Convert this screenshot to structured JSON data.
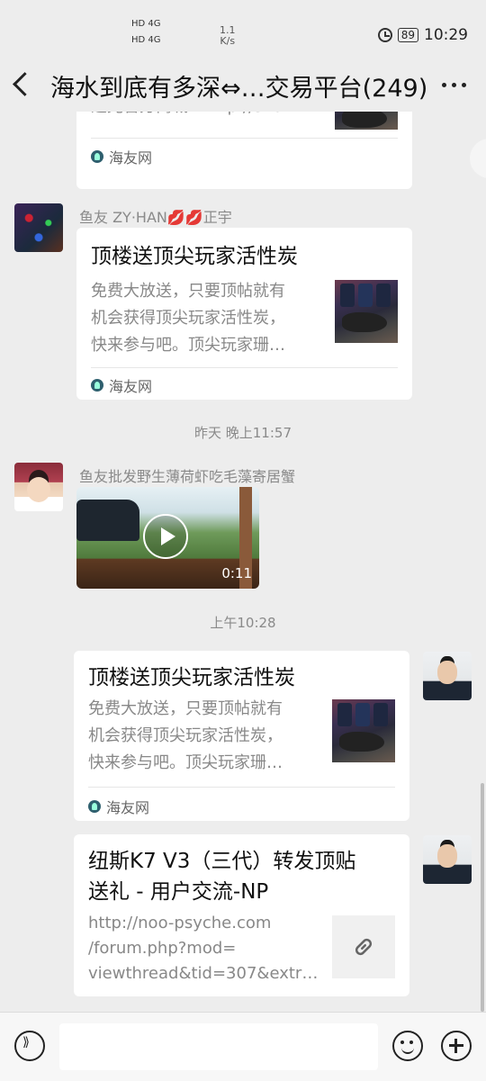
{
  "status_bar": {
    "sig1": "HD 4G",
    "sig2": "HD 4G",
    "speed_value": "1.1",
    "speed_unit": "K/s",
    "battery": "89",
    "time": "10:29"
  },
  "header": {
    "title": "海水到底有多深⇔…交易平台(249)"
  },
  "messages": {
    "m1": {
      "desc": "迈光官方商城：http://sho…",
      "source": "海友网"
    },
    "m2": {
      "sender": "鱼友 ZY·HAN💋💋正宇",
      "title": "顶楼送顶尖玩家活性炭",
      "desc_lines": [
        "免费大放送，只要顶帖就有",
        "机会获得顶尖玩家活性炭，",
        "快来参与吧。顶尖玩家珊…"
      ],
      "source": "海友网"
    },
    "ts1": "昨天 晚上11:57",
    "m3": {
      "sender": "鱼友批发野生薄荷虾吃毛藻寄居蟹",
      "duration": "0:11"
    },
    "ts2": "上午10:28",
    "m4": {
      "title": "顶楼送顶尖玩家活性炭",
      "desc_lines": [
        "免费大放送，只要顶帖就有",
        "机会获得顶尖玩家活性炭，",
        "快来参与吧。顶尖玩家珊…"
      ],
      "source": "海友网"
    },
    "m5": {
      "title_lines": [
        "纽斯K7 V3（三代）转发顶贴",
        "送礼 - 用户交流-NP"
      ],
      "url_lines": [
        "http://noo-psyche.com",
        "/forum.php?mod=",
        "viewthread&tid=307&extr…"
      ]
    }
  },
  "icons": {
    "back": "back-arrow-icon",
    "more": "more-dots-icon",
    "voice": "voice-icon",
    "emoji": "emoji-icon",
    "plus": "plus-icon",
    "link": "link-icon"
  }
}
